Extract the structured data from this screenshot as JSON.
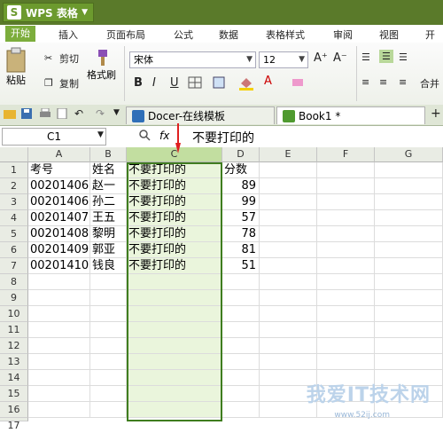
{
  "app": {
    "title": "WPS 表格",
    "logo_letter": "S",
    "dropdown": "▼"
  },
  "menu": {
    "items": [
      "开始",
      "插入",
      "页面布局",
      "公式",
      "数据",
      "表格样式",
      "审阅",
      "视图",
      "开发"
    ]
  },
  "ribbon": {
    "paste": "粘贴",
    "cut": "剪切",
    "copy": "复制",
    "format_painter": "格式刷",
    "font": "宋体",
    "size": "12",
    "bold": "B",
    "italic": "I",
    "underline": "U",
    "merge": "合并"
  },
  "tabs": {
    "docer": "Docer-在线模板",
    "book": "Book1 *",
    "add": "+"
  },
  "formula": {
    "cell_ref": "C1",
    "fx": "fx",
    "content": "不要打印的"
  },
  "grid": {
    "columns": [
      "A",
      "B",
      "C",
      "D",
      "E",
      "F",
      "G"
    ],
    "rows": [
      "1",
      "2",
      "3",
      "4",
      "5",
      "6",
      "7",
      "8",
      "9",
      "10",
      "11",
      "12",
      "13",
      "14",
      "15",
      "16",
      "17"
    ],
    "data": [
      [
        "考号",
        "姓名",
        "不要打印的",
        "分数"
      ],
      [
        "00201406",
        "赵一",
        "不要打印的",
        "89"
      ],
      [
        "00201406",
        "孙二",
        "不要打印的",
        "99"
      ],
      [
        "00201407",
        "王五",
        "不要打印的",
        "57"
      ],
      [
        "00201408",
        "黎明",
        "不要打印的",
        "78"
      ],
      [
        "00201409",
        "郭亚",
        "不要打印的",
        "81"
      ],
      [
        "00201410",
        "钱良",
        "不要打印的",
        "51"
      ]
    ],
    "selected_column": "C"
  },
  "watermark": {
    "text": "我爱IT技术网",
    "url": "www.52ij.com"
  },
  "colors": {
    "title": "#5a7a2a",
    "accent": "#7cad3c",
    "selection": "#3f7d1f",
    "arrow": "#e02020"
  }
}
